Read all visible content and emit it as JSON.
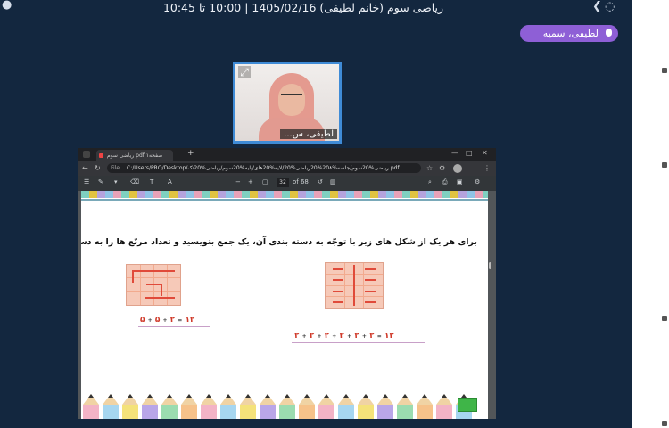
{
  "header": {
    "meeting_title": "ریاضی سوم (خانم لطیفی) 1405/02/16 | 10:00 تا 10:45"
  },
  "speaker": {
    "name": "لطیفی، سمیه"
  },
  "camera": {
    "participant_name": "لطیفی، س..."
  },
  "browser": {
    "tab_title": "ریاضی سوم pdf ۱صفحه",
    "address_label": "File",
    "url": "C:/Users/PRO/Desktop/ریاضی%20سوم/جلسه%20۸%20ریاضی%20/لایه%20های/پایه%20سوم/ریاضی%20تک.pdf",
    "page_number": "32",
    "page_total": "of 68",
    "zoom_label": "-   +"
  },
  "worksheet": {
    "question": "برای هر یک از شکل های زیر با توجّه به دسته بندی آن، یک جمع بنویسید و تعداد مربّع ها را به دست آورید.",
    "left_equation": [
      "۵",
      "+",
      "۵",
      "+",
      "۲",
      "=",
      "۱۲"
    ],
    "right_equation": [
      "۲",
      "+",
      "۲",
      "+",
      "۲",
      "+",
      "۲",
      "+",
      "۲",
      "+",
      "۲",
      "=",
      "۱۲"
    ]
  },
  "colors": {
    "meeting_bg": "#13273f",
    "speaker_pill": "#8e5fd6",
    "camera_border": "#3f8bd6",
    "grid_fill": "#f6c9b8",
    "answer_red": "#d03a2a"
  }
}
